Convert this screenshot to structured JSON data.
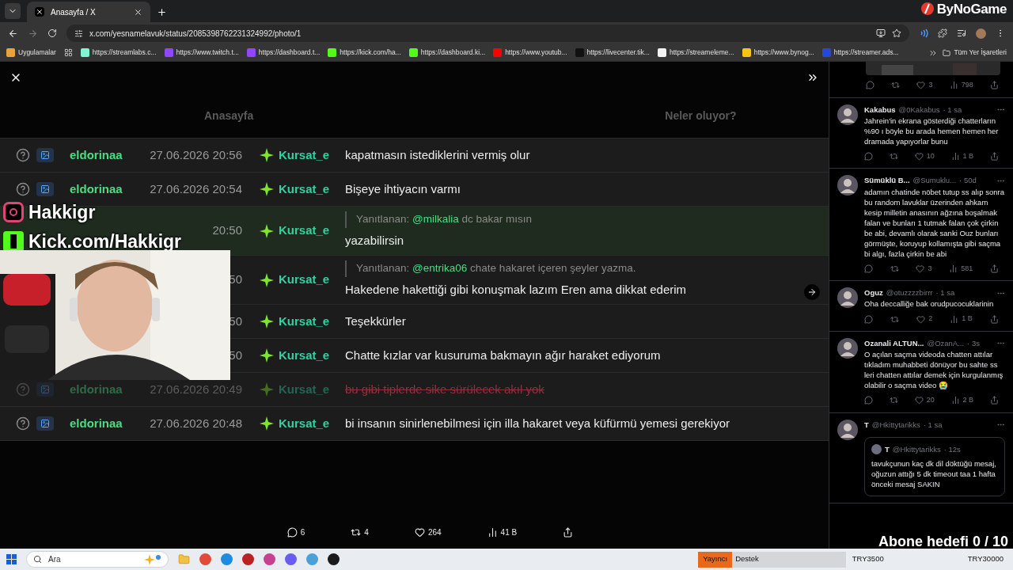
{
  "browser": {
    "tab_title": "Anasayfa / X",
    "url": "x.com/yesnamelavuk/status/2085398762231324992/photo/1",
    "bookmarks": [
      {
        "label": "Uygulamalar",
        "color": "#e8a33d"
      },
      {
        "label": "https://streamlabs.c...",
        "color": "#80f5d2"
      },
      {
        "label": "https://www.twitch.t...",
        "color": "#9146ff"
      },
      {
        "label": "https://dashboard.t...",
        "color": "#9146ff"
      },
      {
        "label": "https://kick.com/ha...",
        "color": "#53fc18"
      },
      {
        "label": "https://dashboard.ki...",
        "color": "#53fc18"
      },
      {
        "label": "https://www.youtub...",
        "color": "#ff0000"
      },
      {
        "label": "https://livecenter.tik...",
        "color": "#111111"
      },
      {
        "label": "https://streameleme...",
        "color": "#f2f2f2"
      },
      {
        "label": "https://www.bynog...",
        "color": "#f5c518"
      },
      {
        "label": "https://streamer.ads...",
        "color": "#2448d8"
      }
    ],
    "all_bookmarks": "Tüm Yer İşaretleri"
  },
  "overlay": {
    "brand": "ByNoGame",
    "social": [
      {
        "kind": "instagram",
        "handle": "Hakkigr"
      },
      {
        "kind": "kick",
        "handle": "Kick.com/Hakkigr"
      }
    ],
    "goal": "Abone hedefi 0 / 10"
  },
  "background": {
    "left_text": "Anasayfa",
    "right_text": "Neler oluyor?"
  },
  "chat": [
    {
      "user": "eldorinaa",
      "stamp": "27.06.2026 20:56",
      "author": "Kursat_e",
      "message": "kapatmasın istediklerini vermiş olur",
      "highlighted": false,
      "deleted": false
    },
    {
      "user": "eldorinaa",
      "stamp": "27.06.2026 20:54",
      "author": "Kursat_e",
      "message": "Bişeye ihtiyacın varmı",
      "highlighted": false,
      "deleted": false
    },
    {
      "stamp": "20:50",
      "author": "Kursat_e",
      "reply": {
        "label": "Yanıtlanan:",
        "mention": "@milkalia",
        "text": "dc bakar mısın"
      },
      "message": "yazabilirsin",
      "highlighted": true,
      "deleted": false
    },
    {
      "stamp": "50",
      "author": "Kursat_e",
      "reply": {
        "label": "Yanıtlanan:",
        "mention": "@entrika06",
        "text": "chate hakaret içeren şeyler yazma."
      },
      "message": "Hakedene hakettiği gibi konuşmak lazım Eren ama dikkat ederim",
      "highlighted": false,
      "deleted": false
    },
    {
      "stamp": "50",
      "author": "Kursat_e",
      "message": "Teşekkürler",
      "highlighted": false,
      "deleted": false
    },
    {
      "stamp": "50",
      "author": "Kursat_e",
      "message": "Chatte kızlar var kusuruma bakmayın ağır haraket ediyorum",
      "highlighted": false,
      "deleted": false
    },
    {
      "user": "eldorinaa",
      "stamp": "27.06.2026 20:49",
      "author": "Kursat_e",
      "message": "bu gibi tiplerde sike sürülecek akıl yok",
      "highlighted": false,
      "deleted": true
    },
    {
      "user": "eldorinaa",
      "stamp": "27.06.2026 20:48",
      "author": "Kursat_e",
      "message": "bi insanın sinirlenebilmesi için illa hakaret veya küfürmü yemesi gerekiyor",
      "highlighted": false,
      "deleted": false
    }
  ],
  "post_actions": {
    "replies": "6",
    "reposts": "4",
    "likes": "264",
    "views": "41 B"
  },
  "first_reply_actions": {
    "likes": "3",
    "views": "798"
  },
  "replies": [
    {
      "name": "Kakabus",
      "handle": "@0Kakabus",
      "time": "· 1 sa",
      "text": "Jahrein'in ekrana gösterdiği chatterların %90 ı böyle bu arada hemen hemen her dramada yapıyorlar bunu",
      "likes": "10",
      "views": "1 B"
    },
    {
      "name": "Sümüklü B...",
      "handle": "@Sumuklu...",
      "time": "· 50d",
      "text": "adamın chatinde nöbet tutup ss alıp sonra bu random lavuklar üzerinden ahkam kesip milletin anasının ağzına boşalmak falan ve bunları 1 tutmak falan çok çirkin be abi, devamlı olarak sanki Ouz bunları görmüşte, koruyup kollamışta gibi saçma bi algı, fazla çirkin be abi",
      "likes": "3",
      "views": "581"
    },
    {
      "name": "Oguz",
      "handle": "@otuzzzzbirrr",
      "time": "· 1 sa",
      "text": "Oha deccalliğe bak orudpucocuklarinin",
      "likes": "2",
      "views": "1 B"
    },
    {
      "name": "Ozanali ALTUN...",
      "handle": "@OzanA...",
      "time": "· 3s",
      "text": "O açılan saçma videoda chatten attılar tıkladım muhabbeti dönüyor bu sahte ss leri chatten attılar demek için kurgulanmış olabilir o saçma video 😭",
      "likes": "20",
      "views": "2 B"
    },
    {
      "name": "T",
      "handle": "@Hkittytarikks",
      "time": "· 1 sa",
      "quote": {
        "name": "T",
        "handle": "@Hkittytarikks",
        "time": "· 12s",
        "text": "tavukçunun kaç dk dil döktüğü mesaj, oğuzun attığı 5 dk timeout taa 1 hafta önceki mesaj SAKIN"
      }
    }
  ],
  "taskbar": {
    "search": "Ara",
    "donation": {
      "label": "Yayıncı",
      "title": "Destek",
      "current": "TRY3500",
      "target": "TRY30000"
    }
  }
}
